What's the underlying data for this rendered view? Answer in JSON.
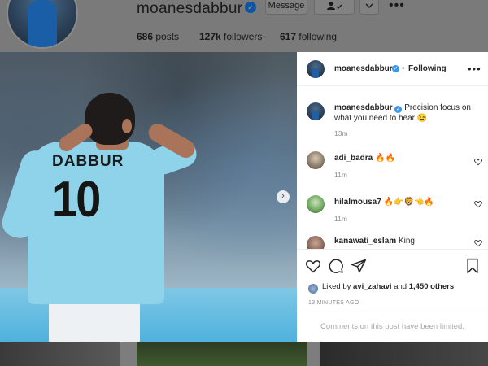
{
  "profile": {
    "username": "moanesdabbur",
    "message_label": "Message",
    "follow_icon": "person-check-icon",
    "chevron_icon": "chevron-down-icon",
    "more_icon": "more-dots-icon",
    "posts_count": "686",
    "posts_label": "posts",
    "followers_count": "127k",
    "followers_label": "followers",
    "following_count": "617",
    "following_label": "following"
  },
  "post": {
    "jersey_name": "DABBUR",
    "jersey_number": "10",
    "next_icon": "chevron-right-icon",
    "header": {
      "username": "moanesdabbur",
      "separator": "•",
      "follow_status": "Following",
      "more_icon": "more-dots-icon"
    },
    "caption": {
      "username": "moanesdabbur",
      "text": "Precision focus on what you need to hear 😉",
      "time": "13m"
    },
    "comments": [
      {
        "username": "adi_badra",
        "text": "🔥🔥",
        "time": "11m"
      },
      {
        "username": "hilalmousa7",
        "text": "🔥👉🦁👈🔥",
        "time": "11m"
      },
      {
        "username": "kanawati_eslam",
        "text": "King",
        "time": ""
      }
    ],
    "actions": {
      "like_icon": "heart-icon",
      "comment_icon": "comment-icon",
      "share_icon": "share-icon",
      "save_icon": "bookmark-icon"
    },
    "likes": {
      "prefix": "Liked by",
      "user": "avi_zahavi",
      "joiner": "and",
      "others": "1,450 others"
    },
    "time_ago": "13 MINUTES AGO",
    "comments_limited": "Comments on this post have been limited."
  }
}
